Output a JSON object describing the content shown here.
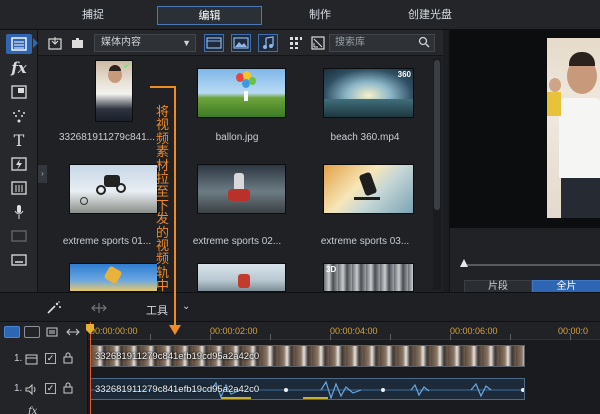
{
  "mode_tabs": {
    "capture": "捕捉",
    "edit": "编辑",
    "produce": "制作",
    "create_disc": "创建光盘"
  },
  "library": {
    "media_filter": "媒体内容",
    "search_placeholder": "搜索库",
    "items": [
      {
        "caption": "332681911279c841...",
        "selected": true
      },
      {
        "caption": "ballon.jpg"
      },
      {
        "caption": "beach 360.mp4",
        "badge": "360"
      },
      {
        "caption": "extreme sports 01..."
      },
      {
        "caption": "extreme sports 02..."
      },
      {
        "caption": "extreme sports 03..."
      },
      {
        "caption": ""
      },
      {
        "caption": ""
      },
      {
        "caption": "",
        "badge": "3D"
      }
    ]
  },
  "annotation": {
    "text": "将视频素材拉至下发的视频轨中",
    "color": "#f08a24"
  },
  "preview": {
    "segment_label": "片段",
    "full_label": "全片"
  },
  "midbar": {
    "tools_label": "工具"
  },
  "timeline": {
    "timecodes": [
      "00:00:00:00",
      "00:00:02:00",
      "00:00:04:00",
      "00:00:06:00",
      "00:00:0"
    ],
    "tracks": [
      {
        "number": "1.",
        "type": "video",
        "clip_name": "332681911279c841efb19cd95a2a42c0"
      },
      {
        "number": "1.",
        "type": "audio",
        "clip_name": "332681911279c841efb19cd95a2a42c0"
      }
    ]
  },
  "colors": {
    "accent": "#2f66b3",
    "timecode": "#d8a43a",
    "playhead": "#e45a2a"
  }
}
